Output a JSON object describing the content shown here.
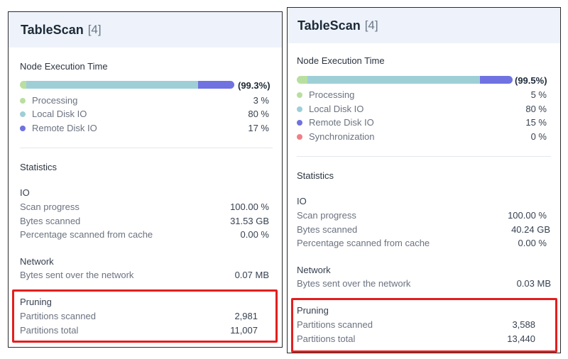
{
  "left": {
    "title": "TableScan",
    "count": "[4]",
    "node_exec": {
      "title": "Node Execution Time",
      "total_pct": "(99.3%)",
      "items": [
        {
          "label": "Processing",
          "value": "3 %",
          "color": "#b9dfa0",
          "fraction": 0.03
        },
        {
          "label": "Local Disk IO",
          "value": "80 %",
          "color": "#9fcfd6",
          "fraction": 0.8
        },
        {
          "label": "Remote Disk IO",
          "value": "17 %",
          "color": "#6f72e0",
          "fraction": 0.17
        }
      ]
    },
    "stats_title": "Statistics",
    "io": {
      "title": "IO",
      "rows": [
        {
          "label": "Scan progress",
          "value": "100.00 %"
        },
        {
          "label": "Bytes scanned",
          "value": "31.53 GB"
        },
        {
          "label": "Percentage scanned from cache",
          "value": "0.00 %"
        }
      ]
    },
    "network": {
      "title": "Network",
      "rows": [
        {
          "label": "Bytes sent over the network",
          "value": "0.07 MB"
        }
      ]
    },
    "pruning": {
      "title": "Pruning",
      "rows": [
        {
          "label": "Partitions scanned",
          "value": "2,981"
        },
        {
          "label": "Partitions total",
          "value": "11,007"
        }
      ]
    }
  },
  "right": {
    "title": "TableScan",
    "count": "[4]",
    "node_exec": {
      "title": "Node Execution Time",
      "total_pct": "(99.5%)",
      "items": [
        {
          "label": "Processing",
          "value": "5 %",
          "color": "#b9dfa0",
          "fraction": 0.05
        },
        {
          "label": "Local Disk IO",
          "value": "80 %",
          "color": "#9fcfd6",
          "fraction": 0.8
        },
        {
          "label": "Remote Disk IO",
          "value": "15 %",
          "color": "#6f72e0",
          "fraction": 0.15
        },
        {
          "label": "Synchronization",
          "value": "0 %",
          "color": "#ef7f87",
          "fraction": 0.0
        }
      ]
    },
    "stats_title": "Statistics",
    "io": {
      "title": "IO",
      "rows": [
        {
          "label": "Scan progress",
          "value": "100.00 %"
        },
        {
          "label": "Bytes scanned",
          "value": "40.24 GB"
        },
        {
          "label": "Percentage scanned from cache",
          "value": "0.00 %"
        }
      ]
    },
    "network": {
      "title": "Network",
      "rows": [
        {
          "label": "Bytes sent over the network",
          "value": "0.03 MB"
        }
      ]
    },
    "pruning": {
      "title": "Pruning",
      "rows": [
        {
          "label": "Partitions scanned",
          "value": "3,588"
        },
        {
          "label": "Partitions total",
          "value": "13,440"
        }
      ]
    }
  },
  "highlight_color": "#e41e1e"
}
